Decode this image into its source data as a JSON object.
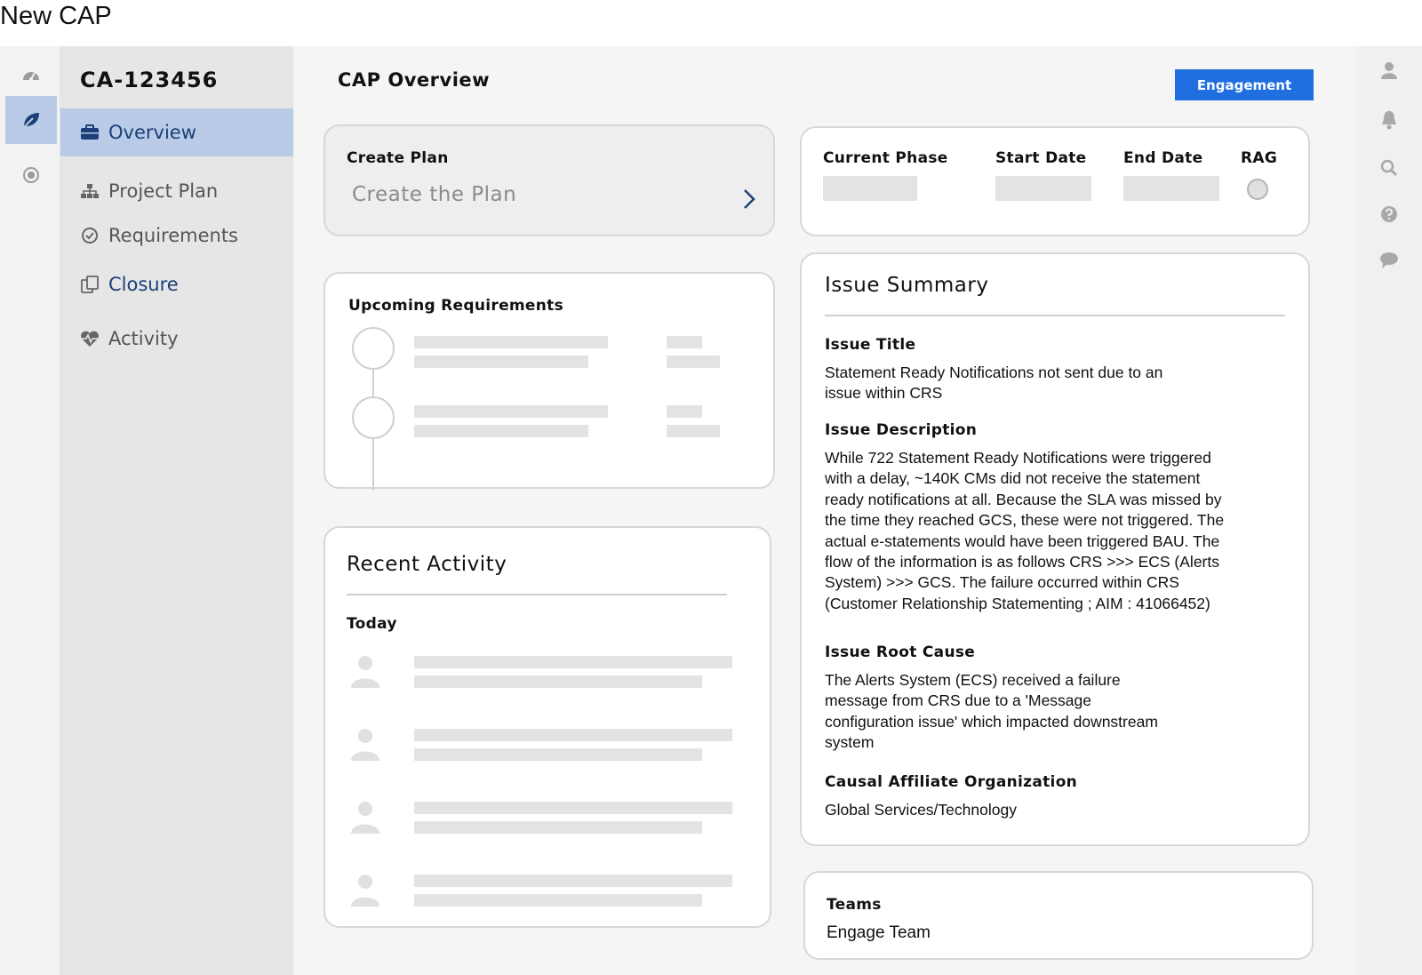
{
  "page": {
    "title": "New CAP"
  },
  "sidebar": {
    "case_id": "CA-123456",
    "items": [
      {
        "label": "Overview"
      },
      {
        "label": "Project Plan"
      },
      {
        "label": "Requirements"
      },
      {
        "label": "Closure"
      },
      {
        "label": "Activity"
      }
    ]
  },
  "main": {
    "title": "CAP Overview",
    "engagement_button": "Engagement"
  },
  "create_plan": {
    "label": "Create Plan",
    "cta": "Create the Plan"
  },
  "phase": {
    "current_phase_label": "Current Phase",
    "start_date_label": "Start Date",
    "end_date_label": "End Date",
    "rag_label": "RAG"
  },
  "upcoming": {
    "title": "Upcoming Requirements"
  },
  "activity": {
    "title": "Recent Activity",
    "group": "Today"
  },
  "issue": {
    "title": "Issue Summary",
    "issue_title_label": "Issue Title",
    "issue_title_lines": [
      "Statement Ready Notifications not sent due to an",
      "issue within CRS"
    ],
    "description_label": "Issue Description",
    "description_lines": [
      "While 722 Statement Ready Notifications were triggered",
      "with a delay, ~140K CMs did not receive the statement",
      "ready notifications at all. Because the SLA was missed by",
      "the time they reached GCS, these were not triggered. The",
      "actual e-statements would have been triggered BAU.  The",
      "flow of the information is as follows CRS >>> ECS (Alerts",
      "System) >>> GCS. The failure occurred within CRS",
      "(Customer Relationship Statementing ; AIM : 41066452)"
    ],
    "root_cause_label": "Issue Root Cause",
    "root_cause_lines": [
      "The Alerts System (ECS) received a failure",
      "message from CRS due to a 'Message",
      "configuration issue' which impacted downstream",
      "system"
    ],
    "affiliate_label": "Causal Affiliate Organization",
    "affiliate_value": "Global Services/Technology"
  },
  "teams": {
    "label": "Teams",
    "value": "Engage Team"
  },
  "icons": {
    "rail": [
      "dashboard-icon",
      "leaf-icon",
      "target-icon"
    ],
    "right_rail": [
      "user-icon",
      "bell-icon",
      "search-icon",
      "help-icon",
      "chat-icon"
    ],
    "accent": "#1f6fe0",
    "active_bg": "#b9cbe6"
  }
}
